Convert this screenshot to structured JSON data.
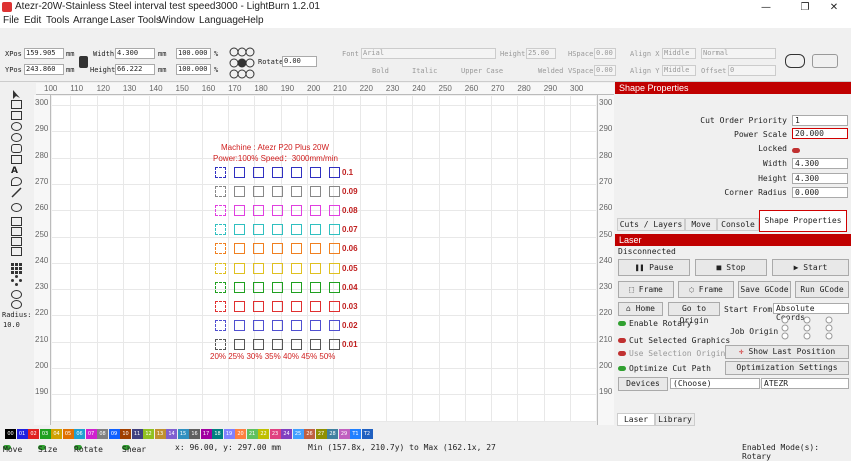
{
  "window": {
    "title": "Atezr-20W-Stainless Steel interval test speed3000 - LightBurn 1.2.01",
    "minimize": "—",
    "restore": "❐",
    "close": "✕"
  },
  "menu": [
    "File",
    "Edit",
    "Tools",
    "Arrange",
    "Laser Tools",
    "Window",
    "Language",
    "Help"
  ],
  "props": {
    "xpos_label": "XPos",
    "xpos": "159.905",
    "ypos_label": "YPos",
    "ypos": "243.860",
    "width_label": "Width",
    "width": "4.300",
    "height_label": "Height",
    "height": "66.222",
    "unit": "mm",
    "scale_w": "100.000",
    "scale_h": "100.000",
    "pct": "%",
    "rotate_label": "Rotate",
    "rotate": "0.00",
    "font_label": "Font",
    "font": "Arial",
    "text_height_label": "Height",
    "text_height": "25.00",
    "hspace_label": "HSpace",
    "hspace": "0.00",
    "vspace_label": "VSpace",
    "vspace": "0.00",
    "align_x_label": "Align X",
    "align_x": "Middle",
    "align_y_label": "Align Y",
    "align_y": "Middle",
    "normal": "Normal",
    "offset_label": "Offset",
    "offset": "0",
    "bold": "Bold",
    "italic": "Italic",
    "upper": "Upper Case",
    "welded": "Welded"
  },
  "rulers": {
    "h": [
      "100",
      "110",
      "120",
      "130",
      "140",
      "150",
      "160",
      "170",
      "180",
      "190",
      "200",
      "210",
      "220",
      "230",
      "240",
      "250",
      "260",
      "270",
      "280",
      "290",
      "300"
    ],
    "v": [
      "300",
      "290",
      "280",
      "270",
      "260",
      "250",
      "240",
      "230",
      "220",
      "210",
      "200",
      "190"
    ]
  },
  "canvas": {
    "machine_line": "Machine : Atezr P20 Plus 20W",
    "power_line": "Power:100% Speed：3000mm/min",
    "row_labels": [
      "0.1",
      "0.09",
      "0.08",
      "0.07",
      "0.06",
      "0.05",
      "0.04",
      "0.03",
      "0.02",
      "0.01"
    ],
    "power_labels": "20% 25% 30% 35% 40% 45% 50%",
    "row_colors": [
      "#3030c0",
      "#888888",
      "#e040e0",
      "#30c0c0",
      "#f08020",
      "#e0c020",
      "#20a020",
      "#e03030",
      "#5050d0",
      "#555555"
    ]
  },
  "left_tools": {
    "radius_label": "Radius:",
    "radius": "10.0"
  },
  "shape_props": {
    "title": "Shape Properties",
    "cut_order_label": "Cut Order Priority",
    "cut_order": "1",
    "power_scale_label": "Power Scale",
    "power_scale": "20.000",
    "locked_label": "Locked",
    "width_label": "Width",
    "width": "4.300",
    "height_label": "Height",
    "height": "4.300",
    "corner_label": "Corner Radius",
    "corner": "0.000"
  },
  "tabs": [
    "Cuts / Layers",
    "Move",
    "Console",
    "Shape Properties"
  ],
  "laser": {
    "title": "Laser",
    "status": "Disconnected",
    "pause": "Pause",
    "stop": "Stop",
    "start": "Start",
    "frame1": "Frame",
    "frame2": "Frame",
    "save_gcode": "Save GCode",
    "run_gcode": "Run GCode",
    "home": "Home",
    "go_origin": "Go to Origin",
    "start_from_label": "Start From:",
    "start_from": "Absolute Coords",
    "enable_rotary": "Enable Rotary",
    "job_origin": "Job Origin",
    "cut_selected": "Cut Selected Graphics",
    "use_selection": "Use Selection Origin",
    "show_last": "Show Last Position",
    "optimize": "Optimize Cut Path",
    "opt_settings": "Optimization Settings",
    "devices": "Devices",
    "choose": "(Choose)",
    "device": "ATEZR"
  },
  "bottom_tabs": [
    "Laser",
    "Library"
  ],
  "palette": [
    "00",
    "01",
    "02",
    "03",
    "04",
    "05",
    "06",
    "07",
    "08",
    "09",
    "10",
    "11",
    "12",
    "13",
    "14",
    "15",
    "16",
    "17",
    "18",
    "19",
    "20",
    "21",
    "22",
    "23",
    "24",
    "25",
    "26",
    "27",
    "28",
    "29",
    "T1",
    "T2"
  ],
  "palette_colors": [
    "#000000",
    "#2020e0",
    "#e02020",
    "#20a020",
    "#d0a000",
    "#e07000",
    "#20a0d0",
    "#d020d0",
    "#808080",
    "#1060ff",
    "#a04000",
    "#404080",
    "#90c020",
    "#c09030",
    "#8060d0",
    "#3090c0",
    "#606060",
    "#a000a0",
    "#008080",
    "#8080ff",
    "#ff8040",
    "#60c060",
    "#c0c000",
    "#e04080",
    "#8040c0",
    "#40a0ff",
    "#c06040",
    "#909000",
    "#4080a0",
    "#c060c0",
    "#2080ff",
    "#2060c0"
  ],
  "status": {
    "move": "Move",
    "size": "Size",
    "rotate": "Rotate",
    "shear": "Shear",
    "coords": "x: 96.00, y: 297.00 mm",
    "range": "Min (157.8x, 210.7y) to Max (162.1x, 27",
    "enabled": "Enabled Mode(s): Rotary"
  }
}
